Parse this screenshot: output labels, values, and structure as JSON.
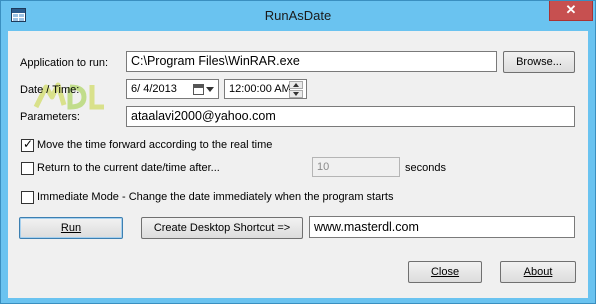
{
  "window": {
    "title": "RunAsDate",
    "close_glyph": "✕",
    "icon": "app-window-icon"
  },
  "form": {
    "application_label": "Application to run:",
    "application_value": "C:\\Program Files\\WinRAR.exe",
    "browse_label": "Browse...",
    "date_time_label": "Date / Time:",
    "date_value": "6/  4/2013",
    "time_value": "12:00:00 AM",
    "parameters_label": "Parameters:",
    "parameters_value": "ataalavi2000@yahoo.com"
  },
  "options": {
    "move_time_forward": {
      "label": "Move the time forward according to the real time",
      "checked": true
    },
    "return_after": {
      "label": "Return to the current date/time after...",
      "checked": false,
      "seconds_value": "10",
      "seconds_label": "seconds"
    },
    "immediate_mode": {
      "label": "Immediate Mode - Change the date immediately when the program starts",
      "checked": false
    }
  },
  "actions": {
    "run_label": "Run",
    "shortcut_label": "Create Desktop Shortcut =>",
    "shortcut_name_value": "www.masterdl.com",
    "close_label": "Close",
    "about_label": "About"
  },
  "watermark": {
    "text": "MDL"
  },
  "colors": {
    "frame": "#6ac3f0",
    "client": "#f0f0f0",
    "close_button": "#c75050"
  }
}
